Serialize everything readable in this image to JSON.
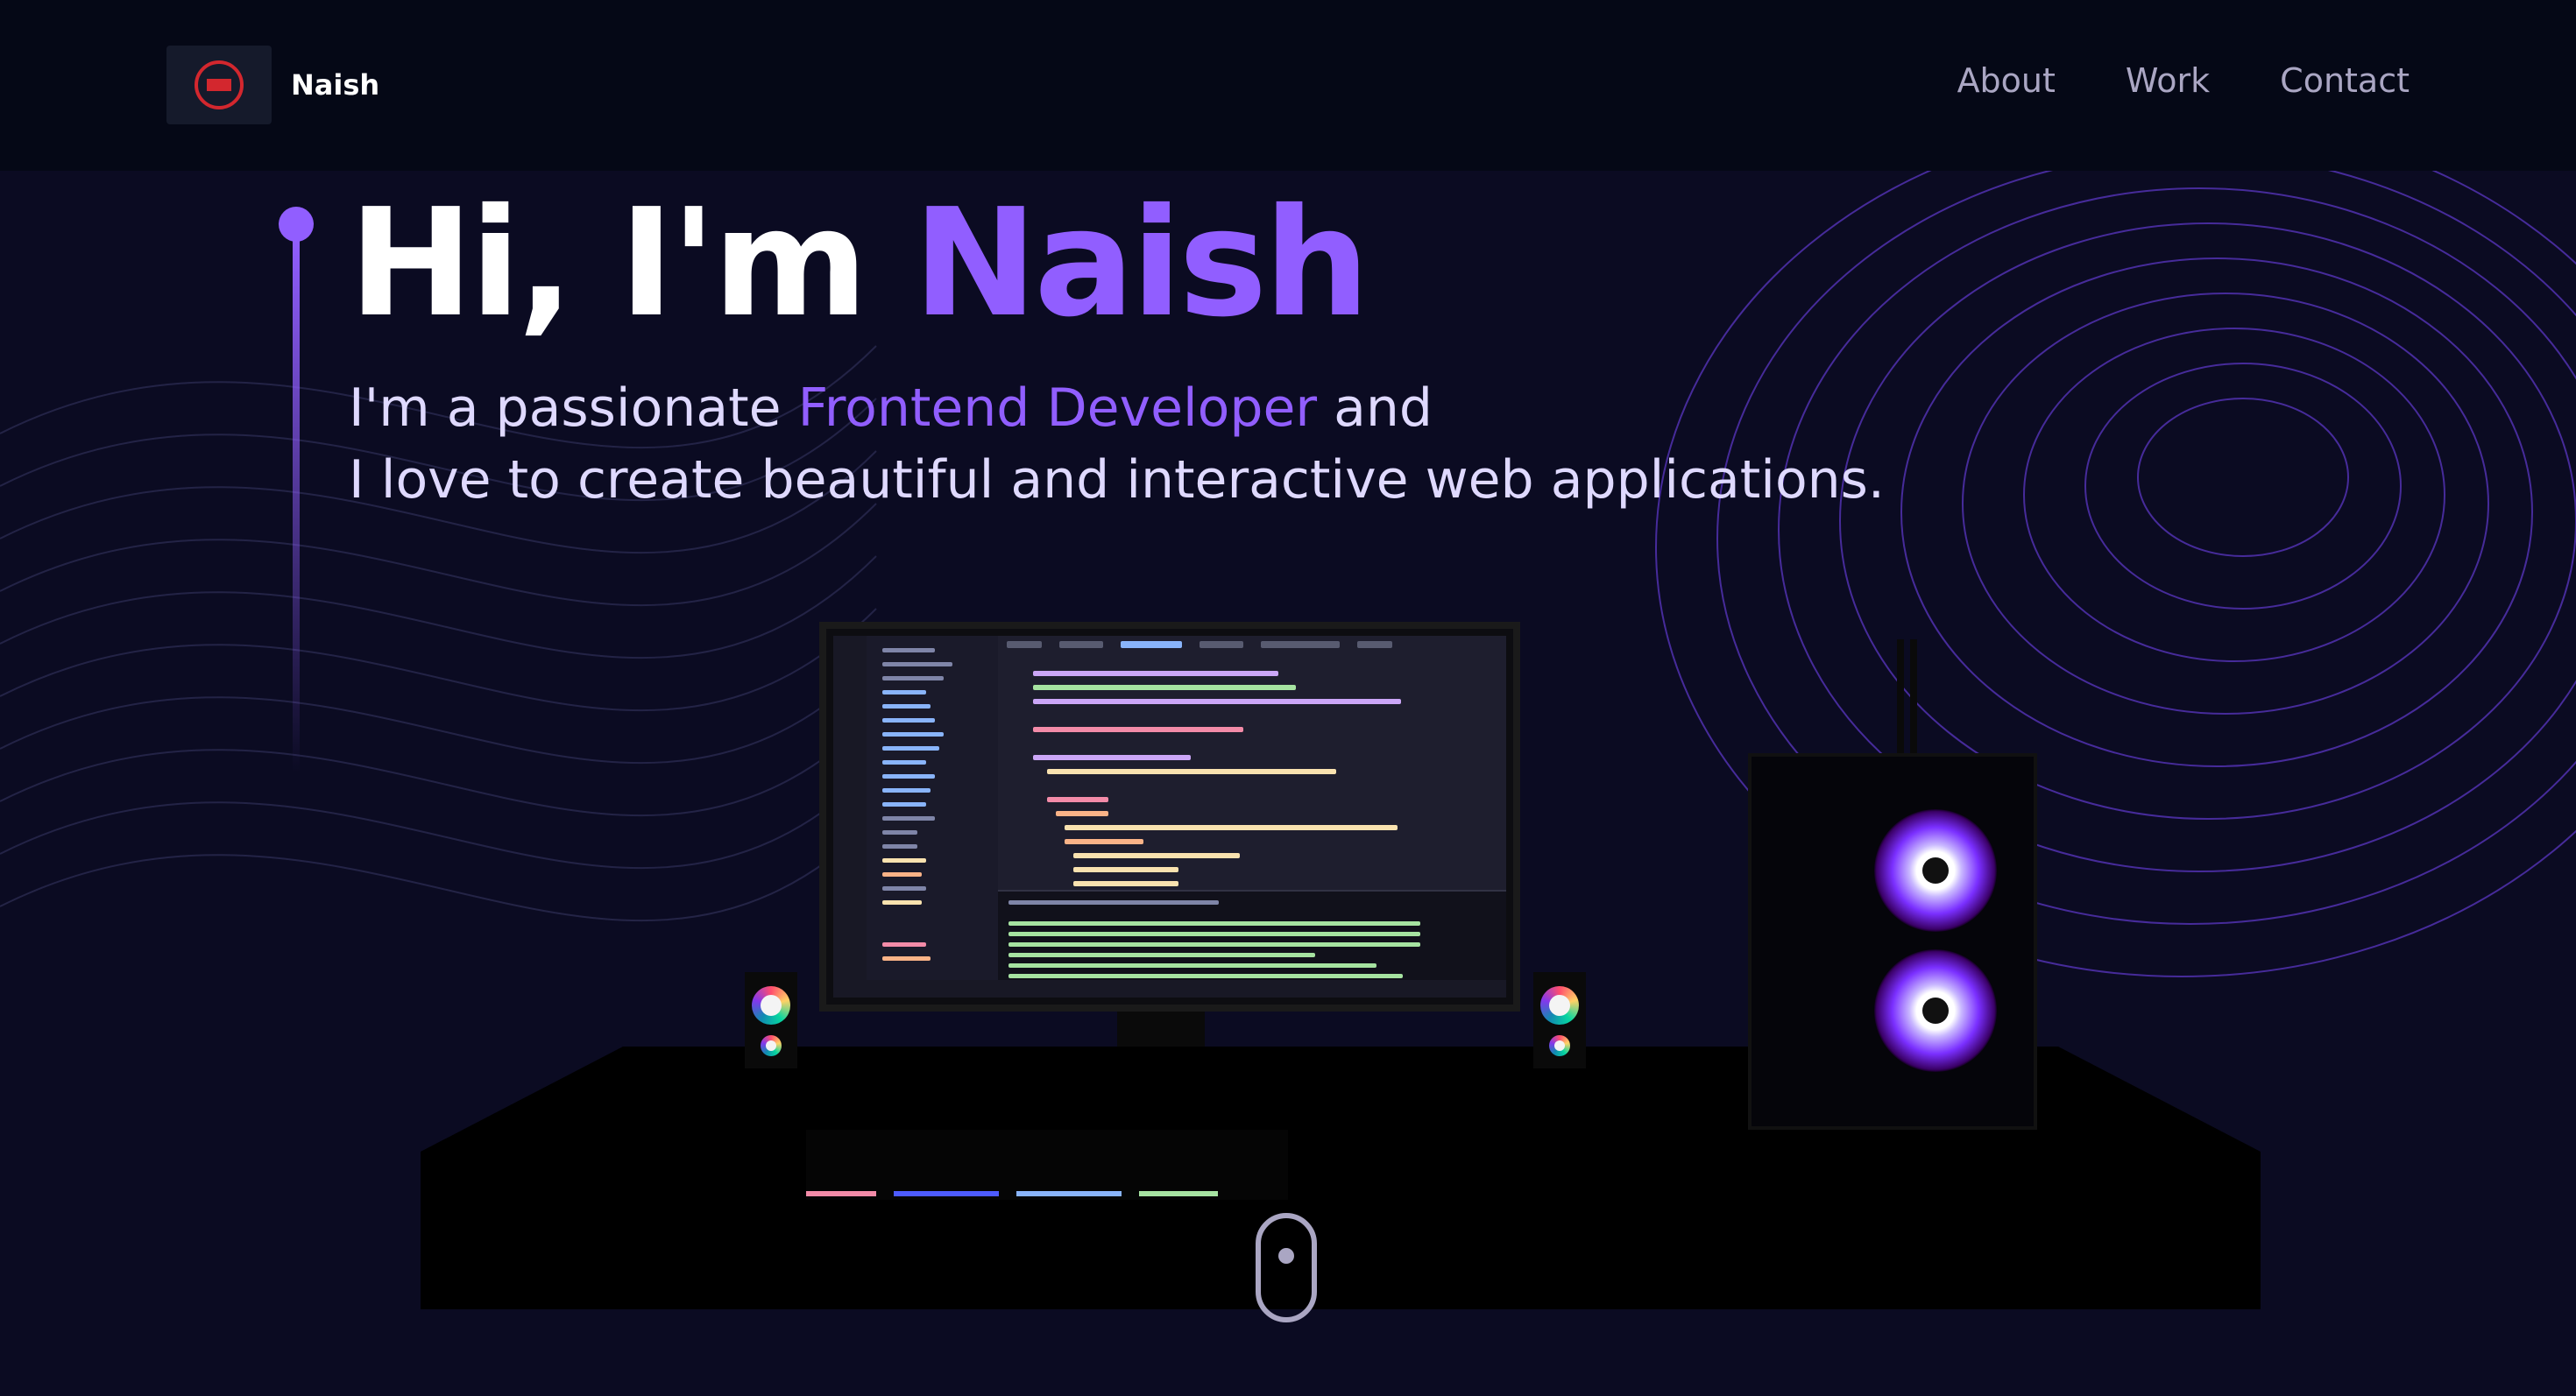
{
  "navbar": {
    "brand": "Naish",
    "links": [
      {
        "label": "About"
      },
      {
        "label": "Work"
      },
      {
        "label": "Contact"
      }
    ]
  },
  "hero": {
    "greeting": "Hi, I'm ",
    "name": "Naish",
    "subtitle_pre": "I'm a passionate ",
    "subtitle_role": "Frontend Developer",
    "subtitle_post": " and",
    "subtitle_line2": "I love to create beautiful and interactive web applications."
  },
  "colors": {
    "background": "#050816",
    "accent": "#915eff",
    "nav_text": "#aaa6c3",
    "logo_red": "#d3272e"
  },
  "icons": {
    "logo": "logo-icon",
    "scroll": "mouse-scroll-icon"
  }
}
